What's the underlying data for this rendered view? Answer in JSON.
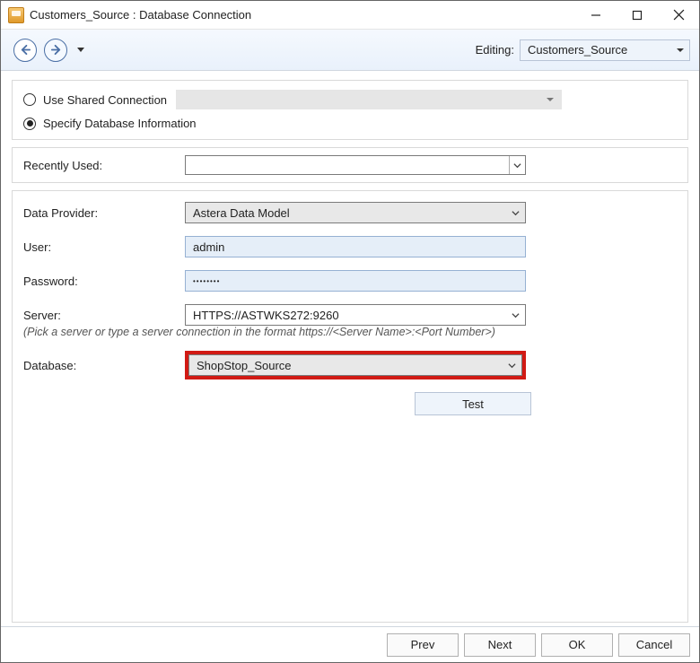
{
  "title": "Customers_Source : Database Connection",
  "toolbar": {
    "editing_label": "Editing:",
    "editing_value": "Customers_Source"
  },
  "connection_mode": {
    "shared_label": "Use Shared Connection",
    "specify_label": "Specify Database Information",
    "selected": "specify"
  },
  "recently_used": {
    "label": "Recently Used:",
    "value": ""
  },
  "form": {
    "data_provider": {
      "label": "Data Provider:",
      "value": "Astera Data Model"
    },
    "user": {
      "label": "User:",
      "value": "admin"
    },
    "password": {
      "label": "Password:",
      "value": "••••••••"
    },
    "server": {
      "label": "Server:",
      "value": "HTTPS://ASTWKS272:9260"
    },
    "server_hint": "(Pick a server or type a server connection in the format  https://<Server Name>:<Port Number>)",
    "database": {
      "label": "Database:",
      "value": "ShopStop_Source"
    },
    "test_label": "Test"
  },
  "footer": {
    "prev": "Prev",
    "next": "Next",
    "ok": "OK",
    "cancel": "Cancel"
  }
}
